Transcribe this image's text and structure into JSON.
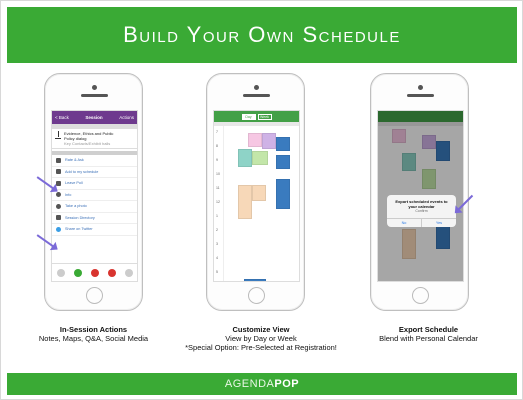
{
  "header": {
    "title": "Build Your Own Schedule"
  },
  "footer": {
    "brand_part1": "AGENDA",
    "brand_part2": "POP"
  },
  "phones": [
    {
      "caption_title": "In-Session Actions",
      "caption_text": "Notes, Maps, Q&A, Social Media",
      "nav": {
        "back": "< Back",
        "title": "Session",
        "right": "Actions"
      },
      "session_line1": "Evidence, Ethics and Public",
      "session_line2": "Policy dialog",
      "session_sub": "Key Contacts/Exhibit halls",
      "menu_items": [
        "Rate & Ask",
        "Add to my schedule",
        "Leave Poll",
        "Info",
        "Take a photo",
        "Session Directory",
        "Share on Twitter"
      ]
    },
    {
      "caption_title": "Customize View",
      "caption_line1": "View by Day or Week",
      "caption_line2": "*Special Option: Pre-Selected at Registration!",
      "seg_day": "Day",
      "seg_week": "Week",
      "time_labels": [
        "7",
        "8",
        "9",
        "10",
        "11",
        "12",
        "1",
        "2",
        "3",
        "4",
        "5"
      ]
    },
    {
      "caption_title": "Export Schedule",
      "caption_text": "Blend with Personal Calendar",
      "dialog_title_1": "Export scheduled events to",
      "dialog_title_2": "your calendar",
      "dialog_sub": "Confirm",
      "dialog_no": "No",
      "dialog_yes": "Yes"
    }
  ],
  "colors": {
    "green": "#3aaa35",
    "purple": "#6e3a8e",
    "arrow": "#7b6ad8"
  }
}
